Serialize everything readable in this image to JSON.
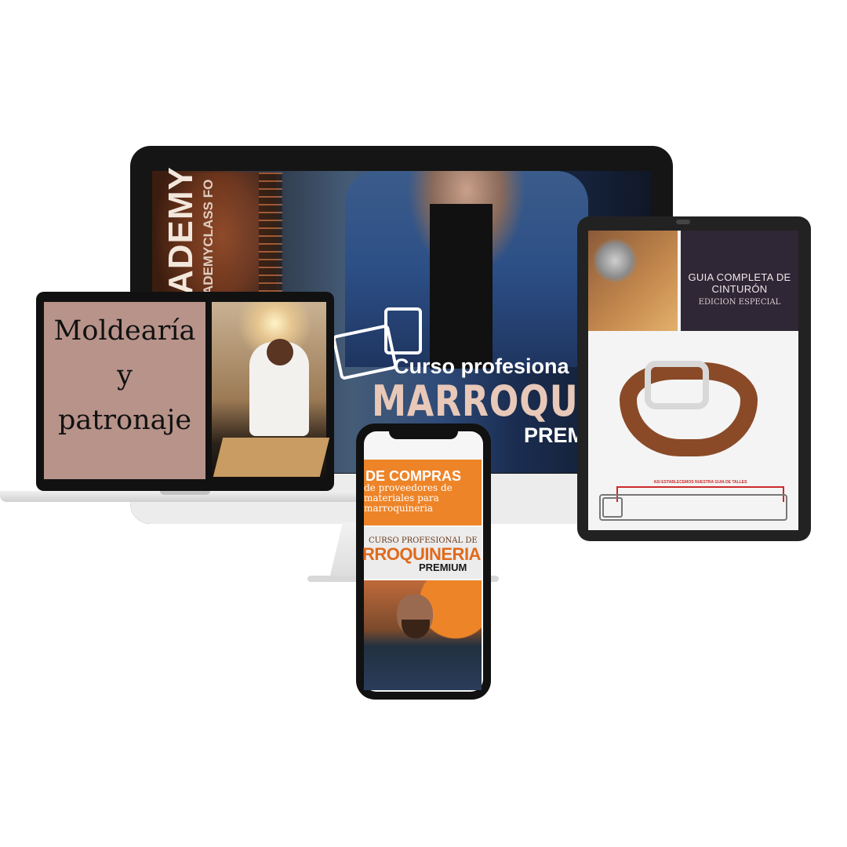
{
  "monitor": {
    "brand_big": "ADEMY",
    "brand_small": "ADEMYCLASS FO",
    "course_line1": "Curso profesiona",
    "course_line2": "MARROQUINE",
    "course_line3": "PREM"
  },
  "laptop": {
    "title_line1": "Moldearía",
    "title_line2": "y",
    "title_line3": "patronaje"
  },
  "tablet": {
    "title": "GUIA COMPLETA DE CINTURÓN",
    "subtitle": "EDICION ESPECIAL",
    "caption": "ASI ESTABLECEMOS NUESTRA GUIA DE TALLES"
  },
  "phone": {
    "title": "DE COMPRAS",
    "subtitle": "de proveedores de materiales para marroquineria",
    "mid_line1": "CURSO PROFESIONAL DE",
    "mid_line2": "RROQUINERIA",
    "mid_line3": "PREMIUM"
  },
  "colors": {
    "laptop_panel": "#b7938a",
    "tablet_title_box": "#2f2735",
    "phone_orange": "#ee8428"
  }
}
